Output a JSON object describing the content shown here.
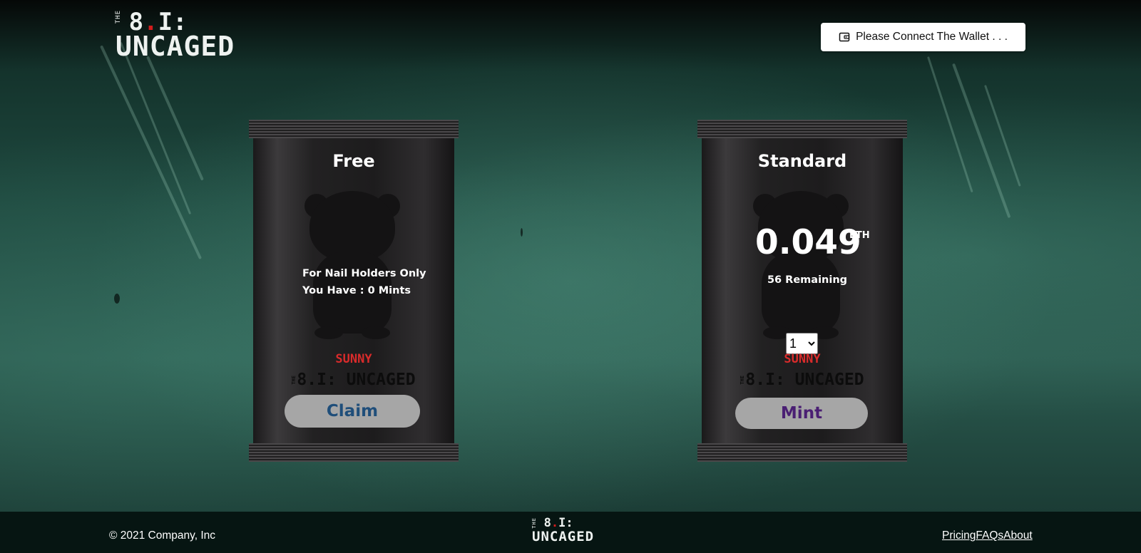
{
  "header": {
    "logo": {
      "the": "THE",
      "number": "8.I:",
      "word": "UNCAGED"
    },
    "wallet_button": {
      "label": "Please Connect The Wallet . . .",
      "icon": "wallet-icon"
    }
  },
  "packs": {
    "free": {
      "title": "Free",
      "line1": "For Nail Holders Only",
      "line2": "You Have : 0 Mints",
      "brand_name": "SUNNY",
      "brand_logo": "8.I: UNCAGED",
      "button_label": "Claim",
      "button_color": "#1f4e7a"
    },
    "standard": {
      "title": "Standard",
      "price": "0.049",
      "currency": "ETH",
      "remaining": "56 Remaining",
      "quantity": "1",
      "brand_name": "SUNNY",
      "brand_logo": "8.I: UNCAGED",
      "button_label": "Mint",
      "button_color": "#4a1f73"
    }
  },
  "footer": {
    "copyright": "© 2021 Company, Inc",
    "logo": {
      "the": "THE",
      "number": "8.I:",
      "word": "UNCAGED"
    },
    "links": [
      "Pricing",
      "FAQs",
      "About"
    ]
  },
  "colors": {
    "accent_red": "#d82b2b",
    "footer_bg": "#061512"
  }
}
